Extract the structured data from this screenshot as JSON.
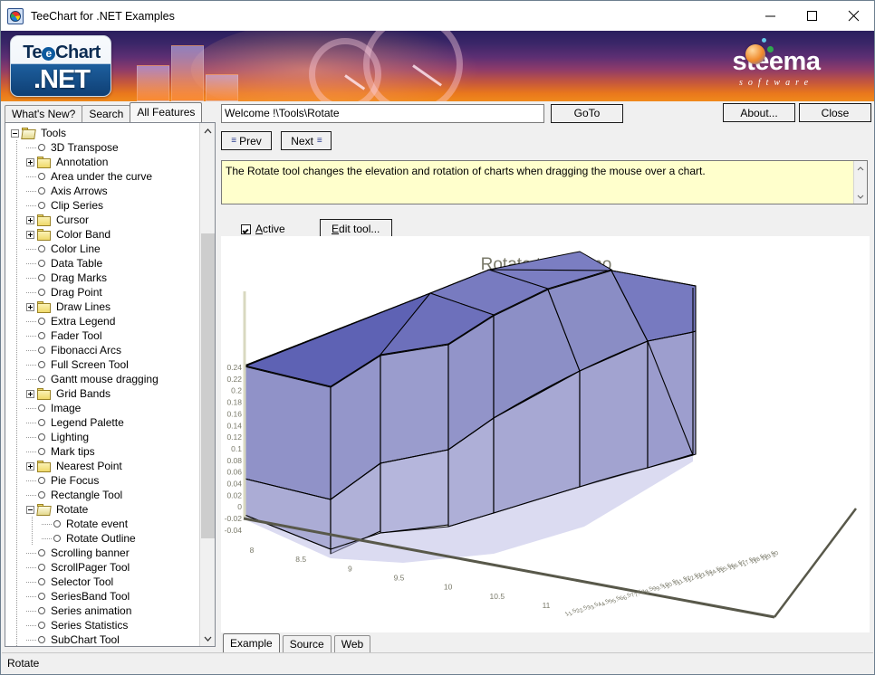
{
  "window": {
    "title": "TeeChart for .NET Examples",
    "icon": "pie-chart-icon",
    "minimize": "—",
    "maximize": "☐",
    "close": "✕"
  },
  "banner": {
    "product_logo_top": "TeeChart",
    "product_logo_bottom": ".NET",
    "company_logo": "steema",
    "company_tagline": "software"
  },
  "left_tabs": [
    {
      "label": "What's New?",
      "active": false
    },
    {
      "label": "Search",
      "active": false
    },
    {
      "label": "All Features",
      "active": true
    }
  ],
  "tree": {
    "nodes": [
      {
        "label": "Tools",
        "level": 0,
        "type": "folder-open",
        "expander": "minus"
      },
      {
        "label": "3D Transpose",
        "level": 1,
        "type": "leaf"
      },
      {
        "label": "Annotation",
        "level": 1,
        "type": "folder",
        "expander": "plus"
      },
      {
        "label": "Area under the curve",
        "level": 1,
        "type": "leaf"
      },
      {
        "label": "Axis Arrows",
        "level": 1,
        "type": "leaf"
      },
      {
        "label": "Clip Series",
        "level": 1,
        "type": "leaf"
      },
      {
        "label": "Cursor",
        "level": 1,
        "type": "folder",
        "expander": "plus"
      },
      {
        "label": "Color Band",
        "level": 1,
        "type": "folder",
        "expander": "plus"
      },
      {
        "label": "Color Line",
        "level": 1,
        "type": "leaf"
      },
      {
        "label": "Data Table",
        "level": 1,
        "type": "leaf"
      },
      {
        "label": "Drag Marks",
        "level": 1,
        "type": "leaf"
      },
      {
        "label": "Drag Point",
        "level": 1,
        "type": "leaf"
      },
      {
        "label": "Draw Lines",
        "level": 1,
        "type": "folder",
        "expander": "plus"
      },
      {
        "label": "Extra Legend",
        "level": 1,
        "type": "leaf"
      },
      {
        "label": "Fader Tool",
        "level": 1,
        "type": "leaf"
      },
      {
        "label": "Fibonacci Arcs",
        "level": 1,
        "type": "leaf"
      },
      {
        "label": "Full Screen Tool",
        "level": 1,
        "type": "leaf"
      },
      {
        "label": "Gantt mouse dragging",
        "level": 1,
        "type": "leaf"
      },
      {
        "label": "Grid Bands",
        "level": 1,
        "type": "folder",
        "expander": "plus"
      },
      {
        "label": "Image",
        "level": 1,
        "type": "leaf"
      },
      {
        "label": "Legend Palette",
        "level": 1,
        "type": "leaf"
      },
      {
        "label": "Lighting",
        "level": 1,
        "type": "leaf"
      },
      {
        "label": "Mark tips",
        "level": 1,
        "type": "leaf"
      },
      {
        "label": "Nearest Point",
        "level": 1,
        "type": "folder",
        "expander": "plus"
      },
      {
        "label": "Pie Focus",
        "level": 1,
        "type": "leaf"
      },
      {
        "label": "Rectangle Tool",
        "level": 1,
        "type": "leaf"
      },
      {
        "label": "Rotate",
        "level": 1,
        "type": "folder-open",
        "expander": "minus"
      },
      {
        "label": "Rotate event",
        "level": 2,
        "type": "leaf"
      },
      {
        "label": "Rotate Outline",
        "level": 2,
        "type": "leaf"
      },
      {
        "label": "Scrolling banner",
        "level": 1,
        "type": "leaf"
      },
      {
        "label": "ScrollPager Tool",
        "level": 1,
        "type": "leaf"
      },
      {
        "label": "Selector Tool",
        "level": 1,
        "type": "leaf"
      },
      {
        "label": "SeriesBand Tool",
        "level": 1,
        "type": "leaf"
      },
      {
        "label": "Series animation",
        "level": 1,
        "type": "leaf"
      },
      {
        "label": "Series Statistics",
        "level": 1,
        "type": "leaf"
      },
      {
        "label": "SubChart Tool",
        "level": 1,
        "type": "leaf"
      }
    ]
  },
  "toolbar": {
    "path_value": "Welcome !\\Tools\\Rotate",
    "path_placeholder": "",
    "goto_label": "GoTo",
    "about_label": "About...",
    "close_label": "Close",
    "prev_label": "Prev",
    "next_label": "Next"
  },
  "description": {
    "text": "The Rotate tool changes the elevation and rotation of charts when dragging the mouse over a chart."
  },
  "options": {
    "active_checkbox_label": "Active",
    "active_checked": true,
    "edit_tool_label": "Edit tool..."
  },
  "bottom_tabs": [
    {
      "label": "Example",
      "active": true
    },
    {
      "label": "Source",
      "active": false
    },
    {
      "label": "Web",
      "active": false
    }
  ],
  "statusbar": {
    "text": "Rotate"
  },
  "chart_data": {
    "type": "surface",
    "title": "Rotate tool demo",
    "xlabel": "",
    "ylabel": "",
    "zlabel": "",
    "grid": true,
    "legend": "none",
    "x_ticks": [
      "8",
      "8.5",
      "9",
      "9.5",
      "10",
      "10.5",
      "11"
    ],
    "xlim": [
      8,
      11
    ],
    "y_ticks": [
      "0.24",
      "0.22",
      "0.2",
      "0.18",
      "0.16",
      "0.14",
      "0.12",
      "0.1",
      "0.08",
      "0.06",
      "0.04",
      "0.02",
      "0",
      "-0.02",
      "-0.04"
    ],
    "ylim": [
      -0.04,
      0.24
    ],
    "z_ticks": [
      "1",
      "1.5",
      "2",
      "2.5",
      "3",
      "3.5",
      "4",
      "4.5",
      "5",
      "5.5",
      "6",
      "6.5",
      "7",
      "7.5",
      "8",
      "8.5",
      "9",
      "9.5",
      "10",
      "10.5",
      "11",
      "11.5",
      "12",
      "12.5",
      "13",
      "13.5",
      "14",
      "14.5",
      "15",
      "15.5",
      "16",
      "16.5",
      "17",
      "17.5",
      "18",
      "18.5",
      "19",
      "19.5",
      "20"
    ],
    "zlim": [
      1,
      20
    ],
    "colors": {
      "surface_dark": "#6064b8",
      "surface_mid": "#8d90c6",
      "surface_light": "#a9aad4",
      "surface_pale": "#b7b7dd",
      "wireframe": "#000000",
      "axis": "#58584a",
      "title": "#7a7a6a",
      "background": "#ffffff"
    }
  }
}
